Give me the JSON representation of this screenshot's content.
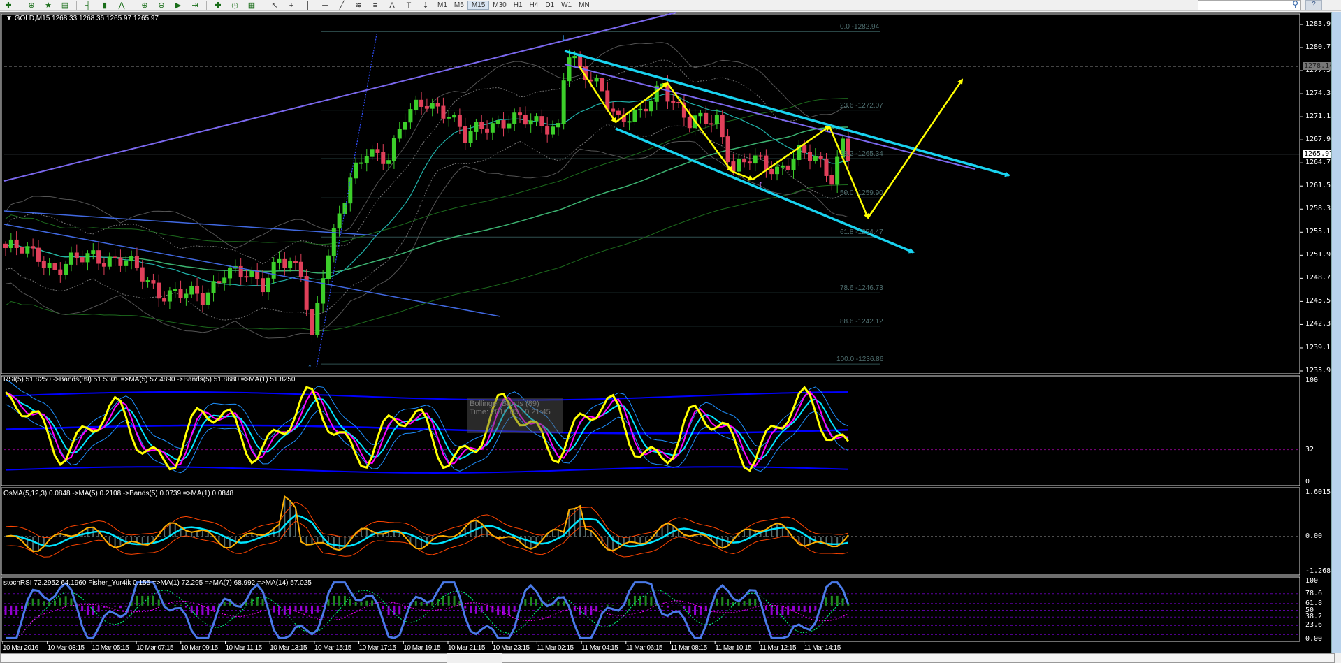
{
  "toolbar": {
    "icons": [
      "new-order-icon",
      "crosshair-icon",
      "favorites-icon",
      "navigator-icon",
      "bar-chart-icon",
      "candle-chart-icon",
      "line-chart-icon",
      "zoom-in-icon",
      "zoom-out-icon",
      "autoscroll-icon",
      "chart-shift-icon",
      "indicators-icon",
      "periods-icon",
      "templates-icon",
      "cursor-icon",
      "crosshair-tool-icon",
      "vertical-line-icon",
      "horizontal-line-icon",
      "trendline-icon",
      "fibonacci-icon",
      "fibo-fan-icon",
      "text-icon",
      "text-label-icon",
      "arrows-icon"
    ],
    "text_tool": "A",
    "label_tool": "T",
    "timeframes": [
      "M1",
      "M5",
      "M15",
      "M30",
      "H1",
      "H4",
      "D1",
      "W1",
      "MN"
    ],
    "active_timeframe": "M15",
    "help_label": "?"
  },
  "chart": {
    "header": "GOLD,M15  1268.33 1268.36 1265.97 1265.97",
    "price_axis": [
      "1283.95",
      "1280.75",
      "1277.55",
      "1274.35",
      "1271.15",
      "1267.95",
      "1264.75",
      "1261.55",
      "1258.35",
      "1255.15",
      "1251.95",
      "1248.75",
      "1245.55",
      "1242.35",
      "1239.10",
      "1235.90"
    ],
    "current_price": "1265.97",
    "level_price": "1278.14",
    "fib_levels": [
      {
        "label": "0.0 -1282.94",
        "price": 1282.94
      },
      {
        "label": "23.6 -1272.07",
        "price": 1272.07
      },
      {
        "label": "38.2 -1265.34",
        "price": 1265.34
      },
      {
        "label": "50.0 -1259.90",
        "price": 1259.9
      },
      {
        "label": "61.8 -1254.47",
        "price": 1254.47
      },
      {
        "label": "78.6 -1246.73",
        "price": 1246.73
      },
      {
        "label": "88.6 -1242.12",
        "price": 1242.12
      },
      {
        "label": "100.0 -1236.86",
        "price": 1236.86
      }
    ],
    "price_keypoints": [
      [
        0,
        1253
      ],
      [
        6,
        1252
      ],
      [
        9,
        1250
      ],
      [
        16,
        1252
      ],
      [
        22,
        1251
      ],
      [
        28,
        1247
      ],
      [
        36,
        1246
      ],
      [
        40,
        1250
      ],
      [
        47,
        1248
      ],
      [
        50,
        1252
      ],
      [
        54,
        1249
      ],
      [
        56,
        1240
      ],
      [
        58,
        1250
      ],
      [
        61,
        1258
      ],
      [
        63,
        1262
      ],
      [
        66,
        1266
      ],
      [
        70,
        1266
      ],
      [
        73,
        1271
      ],
      [
        77,
        1273
      ],
      [
        81,
        1272
      ],
      [
        84,
        1268
      ],
      [
        88,
        1270
      ],
      [
        92,
        1271
      ],
      [
        97,
        1270
      ],
      [
        101,
        1270
      ],
      [
        102,
        1277
      ],
      [
        103,
        1280
      ],
      [
        105,
        1277
      ],
      [
        109,
        1275
      ],
      [
        112,
        1271
      ],
      [
        116,
        1271
      ],
      [
        120,
        1276
      ],
      [
        125,
        1270
      ],
      [
        130,
        1271
      ],
      [
        133,
        1264
      ],
      [
        136,
        1265
      ],
      [
        141,
        1264
      ],
      [
        145,
        1266
      ],
      [
        148,
        1265
      ],
      [
        151,
        1263
      ],
      [
        153,
        1268
      ],
      [
        154,
        1266
      ]
    ]
  },
  "rsi": {
    "header": "RSI(5) 51.8250  ->Bands(89) 51.5301  =>MA(5) 57.4890  ->Bands(5) 51.8680  =>MA(1) 51.8250",
    "axis": [
      "100",
      "32",
      "0"
    ],
    "tooltip_title": "Bollinger Bands (89)",
    "tooltip_line": "Time: 2016.03.10 21:45"
  },
  "osma": {
    "header": "OsMA(5,12,3) 0.0848  ->MA(5) 0.2108  ->Bands(5) 0.0739  =>MA(1) 0.0848",
    "axis": [
      "1.6015",
      "0.00",
      "-1.2681"
    ]
  },
  "stoch": {
    "header": "stochRSI 72.2952 64.1960  Fisher_Yur4ik 0.155  =>MA(1) 72.295  =>MA(7) 68.992  =>MA(14) 57.025",
    "axis": [
      "100",
      "78.6",
      "61.8",
      "50",
      "38.2",
      "23.6",
      "0.00"
    ]
  },
  "time_axis": [
    "10 Mar 2016",
    "10 Mar 03:15",
    "10 Mar 05:15",
    "10 Mar 07:15",
    "10 Mar 09:15",
    "10 Mar 11:15",
    "10 Mar 13:15",
    "10 Mar 15:15",
    "10 Mar 17:15",
    "10 Mar 19:15",
    "10 Mar 21:15",
    "10 Mar 23:15",
    "11 Mar 02:15",
    "11 Mar 04:15",
    "11 Mar 06:15",
    "11 Mar 08:15",
    "11 Mar 10:15",
    "11 Mar 12:15",
    "11 Mar 14:15"
  ],
  "colors": {
    "bull": "#3ccf2a",
    "bear": "#e0405a",
    "arrow": "#ffff00",
    "channel": "#19d3f0",
    "trend_purple": "#7b68ee",
    "trend_blue": "#4169e1",
    "rsi": "#ffff00",
    "ma": "#ff00ff",
    "cyan": "#00e5ff",
    "band": "#0000ff",
    "osma_line": "#ffb000",
    "osma_band": "#ff4500",
    "fisher": "#4a7ae8",
    "hist_up": "#1f8a1f",
    "hist_dn": "#9400d3"
  }
}
